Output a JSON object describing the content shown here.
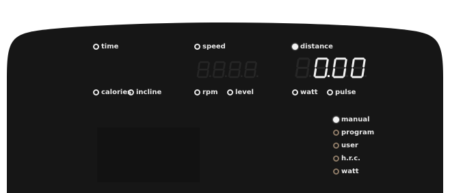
{
  "colors": {
    "panel": "#161616",
    "led_on": "#f4f4f4",
    "led_off": "#eaeaea",
    "led_dim": "#8d7a66",
    "segment_lit": "#f2f2f2",
    "segment_ghost": "#262626"
  },
  "indicators": {
    "time": {
      "label": "time",
      "lit": false
    },
    "speed": {
      "label": "speed",
      "lit": false
    },
    "distance": {
      "label": "distance",
      "lit": true
    },
    "calories": {
      "label": "calories",
      "lit": false
    },
    "incline": {
      "label": "incline",
      "lit": false
    },
    "rpm": {
      "label": "rpm",
      "lit": false
    },
    "level": {
      "label": "level",
      "lit": false
    },
    "watt": {
      "label": "watt",
      "lit": false
    },
    "pulse": {
      "label": "pulse",
      "lit": false
    }
  },
  "displays": {
    "speed": {
      "value": ""
    },
    "distance": {
      "value": "0.00"
    }
  },
  "programs": [
    {
      "label": "manual",
      "selected": true
    },
    {
      "label": "program",
      "selected": false
    },
    {
      "label": "user",
      "selected": false
    },
    {
      "label": "h.r.c.",
      "selected": false
    },
    {
      "label": "watt",
      "selected": false
    }
  ]
}
